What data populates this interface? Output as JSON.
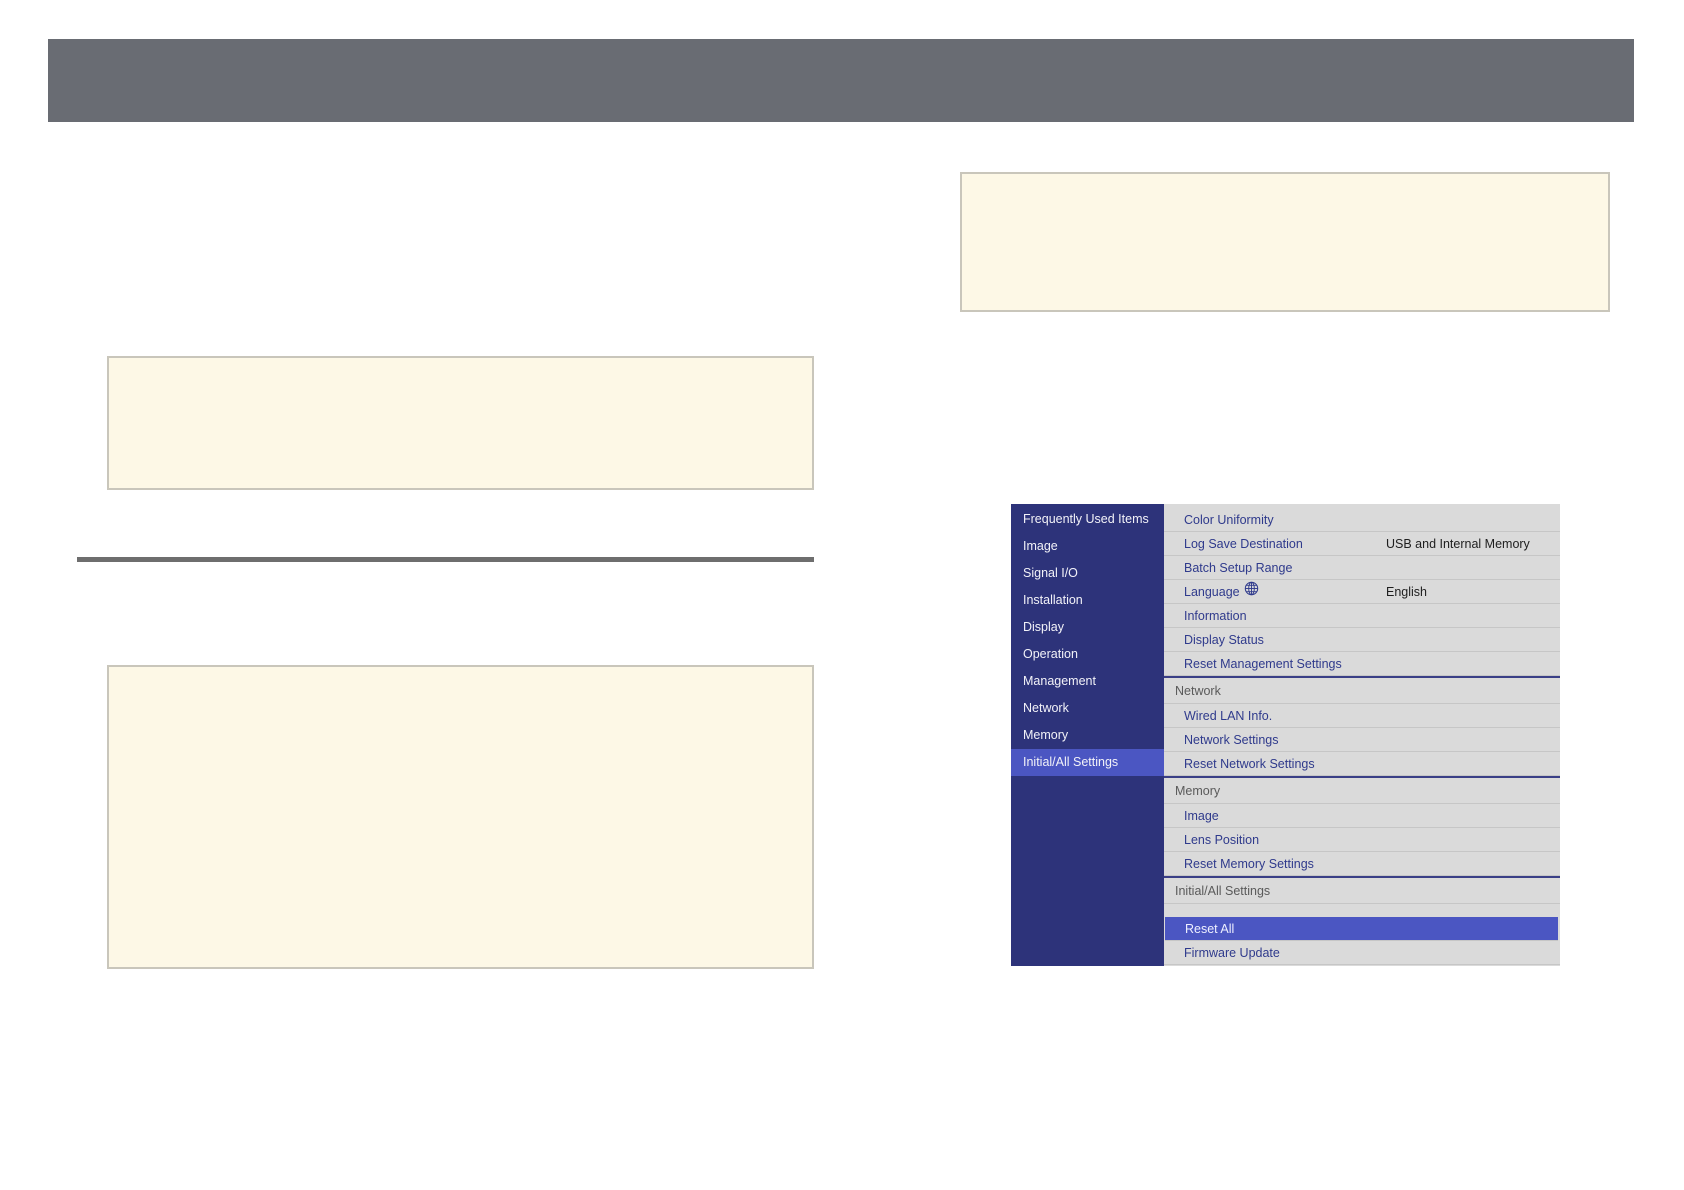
{
  "menu": {
    "categories": [
      "Frequently Used Items",
      "Image",
      "Signal I/O",
      "Installation",
      "Display",
      "Operation",
      "Management",
      "Network",
      "Memory",
      "Initial/All Settings"
    ],
    "selected_category": "Initial/All Settings",
    "rows": {
      "color_uniformity": "Color Uniformity",
      "log_save_destination": "Log Save Destination",
      "log_save_destination_value": "USB and Internal Memory",
      "batch_setup_range": "Batch Setup Range",
      "language": "Language",
      "language_value": "English",
      "information": "Information",
      "display_status": "Display Status",
      "reset_management_settings": "Reset Management Settings",
      "network_header": "Network",
      "wired_lan_info": "Wired LAN Info.",
      "network_settings": "Network Settings",
      "reset_network_settings": "Reset Network Settings",
      "memory_header": "Memory",
      "image": "Image",
      "lens_position": "Lens Position",
      "reset_memory_settings": "Reset Memory Settings",
      "initial_all_header": "Initial/All Settings",
      "reset_all": "Reset All",
      "firmware_update": "Firmware Update"
    },
    "selected_item": "Reset All",
    "colors": {
      "sidebar": "#2d337a",
      "highlight": "#4b56c2",
      "panel": "#dadada"
    }
  },
  "icons": {
    "language": "globe-icon"
  }
}
